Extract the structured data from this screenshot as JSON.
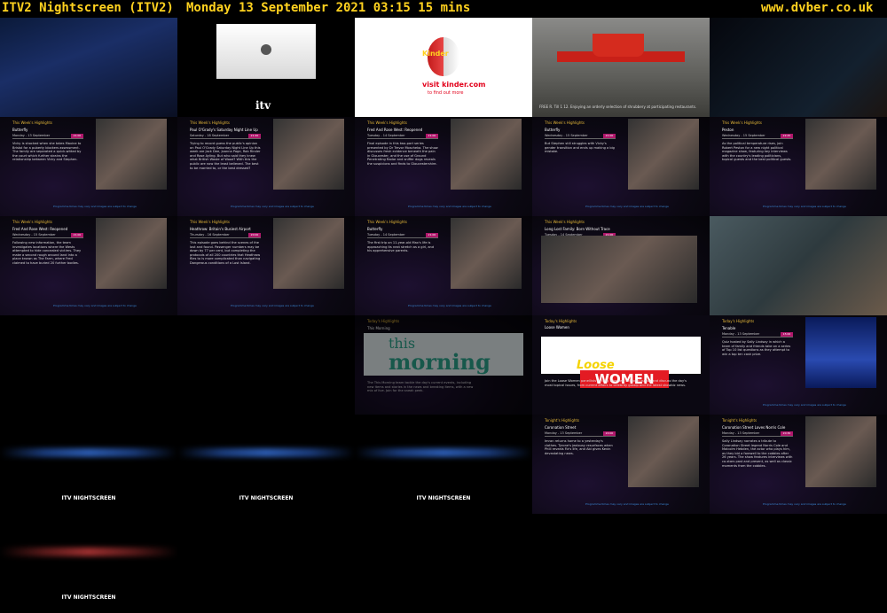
{
  "header": {
    "channel": "ITV2 Nightscreen (ITV2)",
    "datetime": "Monday 13 September 2021  03:15  15 mins",
    "site": "www.dvber.co.uk"
  },
  "brand": {
    "itv_logo": "itv",
    "itv_nightscreen": "ITV NIGHTSCREEN"
  },
  "ads": {
    "kinder": {
      "brand": "Kinder",
      "surprise": "Surprise",
      "visit": "visit kinder.com",
      "tofind": "to find out more"
    },
    "kfc_caption": "FREE R. Till 1 12. Enjoying an orderly selection of shrubbery at participating restaurants."
  },
  "highlights": [
    {
      "title": "This Week's Highlights",
      "prog": "Butterfly",
      "date": "Monday - 13 September",
      "time": "21:00",
      "text": "Vicky is shocked when she takes Maxine to Bristol for a puberty blockers assessment. The family are separated a quick-witted by the court which further strains the relationship between Vicky and Stephen."
    },
    {
      "title": "This Week's Highlights",
      "prog": "Paul O'Grady's Saturday Night Line Up",
      "date": "Saturday - 18 September",
      "time": "21:40",
      "text": "Trying to record guess the public's opinion on Paul O'Grady Saturday Night Line Up this week are Jack Dee, Joanna Page, Rob Rinder and Rose Ayling. But who said they knew what British Waste of Wood? With this the public are now the least believed. The best to be married to, or the best dressed?"
    },
    {
      "title": "This Week's Highlights",
      "prog": "Fred And Rose West: Reopened",
      "date": "Tuesday - 14 September",
      "time": "21:00",
      "text": "Final episode in this two-part series presented by Dr Trevor Moscheka. The show discusses fresh evidence beneath the pain in Gloucester, and the use of Ground Penetrating Radar and sniffer dogs reveals the suspicions and finds to Gloucestershire."
    },
    {
      "title": "This Week's Highlights",
      "prog": "Butterfly",
      "date": "Wednesday - 15 September",
      "time": "21:00",
      "text": "But Stephen still struggles with Vicky's gender transition and ends up making a big mistake."
    },
    {
      "title": "This Week's Highlights",
      "prog": "Peston",
      "date": "Wednesday - 15 September",
      "time": "22:45",
      "text": "As the political temperature rises, join Robert Peston for a new night political magazine show, featuring key interviews with the country's leading politicians, topical guests and the best political guests."
    },
    {
      "title": "This Week's Highlights",
      "prog": "Fred And Rose West: Reopened",
      "date": "Wednesday - 15 September",
      "time": "21:00",
      "text": "Following new information, the team investigates locations where the Wests attempted to hide concealed victims. They make a second rough around land into a place known as The Farm, where Fred claimed to have buried 20 further bodies."
    },
    {
      "title": "This Week's Highlights",
      "prog": "Heathrow: Britain's Busiest Airport",
      "date": "Thursday - 16 September",
      "time": "20:00",
      "text": "This episode goes behind the scenes of the lost and found. Passenger numbers may be down by 77 per cent, but completing the protocols of all 200 countries that Heathrow flies to is more complicated than navigating Dangerous conditions of a Lost Island."
    },
    {
      "title": "This Week's Highlights",
      "prog": "Butterfly",
      "date": "Tuesday - 14 September",
      "time": "21:00",
      "text": "The first trip on 11-year-old Max's life is approaching its next stretch as a girl, and his apprehensive parents."
    },
    {
      "title": "This Week's Highlights",
      "prog": "Long Lost Family: Born Without Trace",
      "date": "Tuesday - 14 September",
      "time": "21:00",
      "text": ""
    },
    {
      "title": "This Week's Highlights",
      "prog": "",
      "date": "",
      "time": "",
      "text": ""
    },
    {
      "title": "Today's Highlights",
      "prog": "This Morning",
      "date": "Monday - 13 September",
      "time": "10:00",
      "text": "The This Morning team tackle the day's current events, including new items and stories in the news and breaking items, with a new mix of live. Join for the sneak peek."
    },
    {
      "title": "Today's Highlights",
      "prog": "Loose Women",
      "date": "Monday - 13 September",
      "time": "12:30",
      "text": "Join the Loose Women panellists as they interview celebrity guests and discuss the day's most topical issues, from current affairs to celebrity gossip and the latest showbiz news."
    },
    {
      "title": "Today's Highlights",
      "prog": "Tenable",
      "date": "Monday - 13 September",
      "time": "15:00",
      "text": "Quiz hosted by Sally Lindsay in which a team of family and friends take on a series of Top 10 list questions as they attempt to win a top ten cash prize."
    },
    {
      "title": "Tonight's Highlights",
      "prog": "Coronation Street",
      "date": "Monday - 13 September",
      "time": "20:00",
      "text": "Imran returns home to a yesterday's clothes. Tyrone's jealousy resurfaces when Phill reveals Fiz's life, and Abi gives Kevin devastating news."
    },
    {
      "title": "Tonight's Highlights",
      "prog": "Coronation Street Loves Norris Cole",
      "date": "Monday - 13 September",
      "time": "20:30",
      "text": "Sally Lindsay narrates a tribute to Coronation Street legend Norris Cole and Malcolm Hebden, the actor who plays him, as they bid a farewell to the cobbles after 26 years. The show features interviews with co-stars past and present, as well as classic moments from the cobbles."
    }
  ],
  "footer_note": "Programme times may vary and images are subject to change",
  "colors": {
    "header_text": "#ffd21f",
    "highlight_title": "#e6b93a",
    "time_badge": "#b0176b",
    "footer_link": "#3b8ad8"
  }
}
